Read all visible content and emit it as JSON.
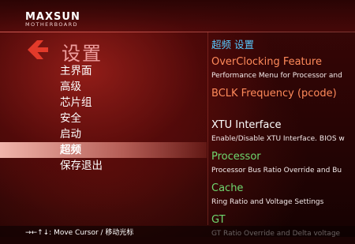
{
  "brand": {
    "name": "MAXSUN",
    "sub": "MOTHERBOARD"
  },
  "left": {
    "title": "设置",
    "items": [
      {
        "label": "主界面"
      },
      {
        "label": "高级"
      },
      {
        "label": "芯片组"
      },
      {
        "label": "安全"
      },
      {
        "label": "启动"
      },
      {
        "label": "超频"
      },
      {
        "label": "保存退出"
      }
    ],
    "selected_index": 5
  },
  "right": {
    "title": "超频 设置",
    "entries": [
      {
        "title": "OverClocking Feature",
        "desc": "Performance Menu for Processor and",
        "color": "#ff8a5a"
      },
      {
        "title": "BCLK Frequency (pcode)",
        "desc": "",
        "color": "#ff8a5a"
      },
      {
        "title": "XTU Interface",
        "desc": "Enable/Disable XTU Interface. BIOS w",
        "color": "#ffffff"
      },
      {
        "title": "Processor",
        "desc": "Processor Bus Ratio Override and Bu",
        "color": "#6fd86f"
      },
      {
        "title": "Cache",
        "desc": "Ring Ratio and Voltage Settings",
        "color": "#6fd86f"
      },
      {
        "title": "GT",
        "desc": "GT Ratio Override and Delta voltage",
        "color": "#6fd86f"
      }
    ]
  },
  "footer": {
    "arrows": "→←↑↓",
    "hint": ": Move Cursor / 移动光标"
  }
}
